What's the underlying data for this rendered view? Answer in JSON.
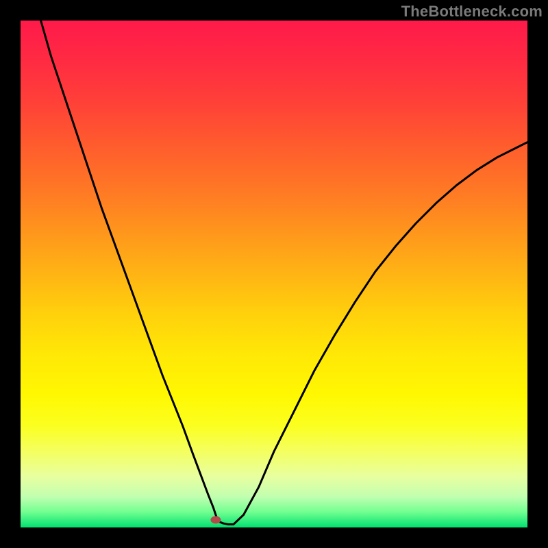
{
  "watermark": "TheBottleneck.com",
  "chart_data": {
    "type": "line",
    "title": "",
    "xlabel": "",
    "ylabel": "",
    "xlim": [
      0,
      100
    ],
    "ylim": [
      0,
      100
    ],
    "grid": false,
    "legend": false,
    "series": [
      {
        "name": "bottleneck-curve",
        "x": [
          4,
          6,
          8,
          10,
          12,
          14,
          16,
          18,
          20,
          22,
          24,
          26,
          28,
          30,
          32,
          34,
          35.5,
          37,
          38,
          38.5,
          39,
          40,
          41,
          42,
          44,
          47,
          50,
          54,
          58,
          62,
          66,
          70,
          74,
          78,
          82,
          86,
          90,
          94,
          98,
          100
        ],
        "y": [
          100,
          93,
          87,
          81,
          75,
          69,
          63,
          57.5,
          52,
          46.5,
          41,
          35.5,
          30,
          25,
          20,
          14.5,
          10.5,
          6.5,
          4,
          2.5,
          1.2,
          0.8,
          0.6,
          0.6,
          2.5,
          8,
          15,
          23,
          31,
          38,
          44.5,
          50.5,
          55.5,
          60,
          64,
          67.5,
          70.5,
          73,
          75,
          76
        ]
      }
    ],
    "marker": {
      "x": 38.5,
      "y": 1.5,
      "color": "#b54a4a"
    },
    "background_gradient": {
      "top": "#ff1a4a",
      "mid": "#ffe806",
      "bottom": "#00e070"
    }
  }
}
